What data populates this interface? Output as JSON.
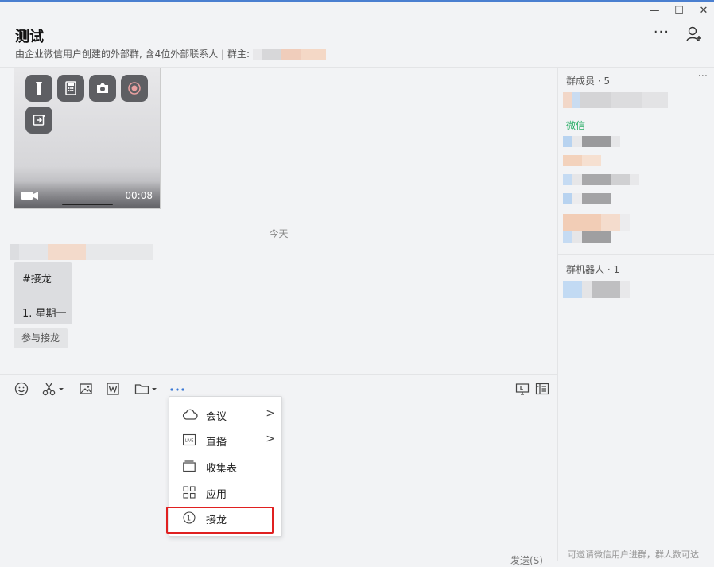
{
  "window": {
    "minimize": "—",
    "maximize": "☐",
    "close": "✕"
  },
  "header": {
    "title": "测试",
    "subtitle": "由企业微信用户创建的外部群, 含4位外部联系人 | 群主:",
    "more": "···"
  },
  "chat": {
    "video_duration": "00:08",
    "date_separator": "今天",
    "message_line1": "#接龙",
    "message_line2": "1. 星期一",
    "join_button": "参与接龙"
  },
  "toolbar": {
    "icons": [
      "emoji-icon",
      "scissors-icon",
      "image-icon",
      "word-doc-icon",
      "folder-icon",
      "more-dots-icon",
      "screen-share-icon",
      "chat-record-icon"
    ]
  },
  "menu": {
    "items": [
      {
        "label": "会议",
        "icon": "cloud-icon",
        "has_submenu": true
      },
      {
        "label": "直播",
        "icon": "live-icon",
        "has_submenu": true
      },
      {
        "label": "收集表",
        "icon": "form-icon",
        "has_submenu": false
      },
      {
        "label": "应用",
        "icon": "apps-grid-icon",
        "has_submenu": false
      },
      {
        "label": "接龙",
        "icon": "relay-icon",
        "has_submenu": false
      }
    ],
    "live_badge": "LIVE",
    "relay_badge": "1"
  },
  "input": {
    "send_label": "发送(S)"
  },
  "side": {
    "members_header": "群成员 · 5",
    "more": "···",
    "wechat_label": "微信",
    "robots_header": "群机器人 · 1",
    "footer": "可邀请微信用户进群，群人数可达"
  },
  "colors": {
    "accent": "#4a7fd0",
    "highlight_box": "#e02020",
    "wechat_green": "#2aae67"
  }
}
